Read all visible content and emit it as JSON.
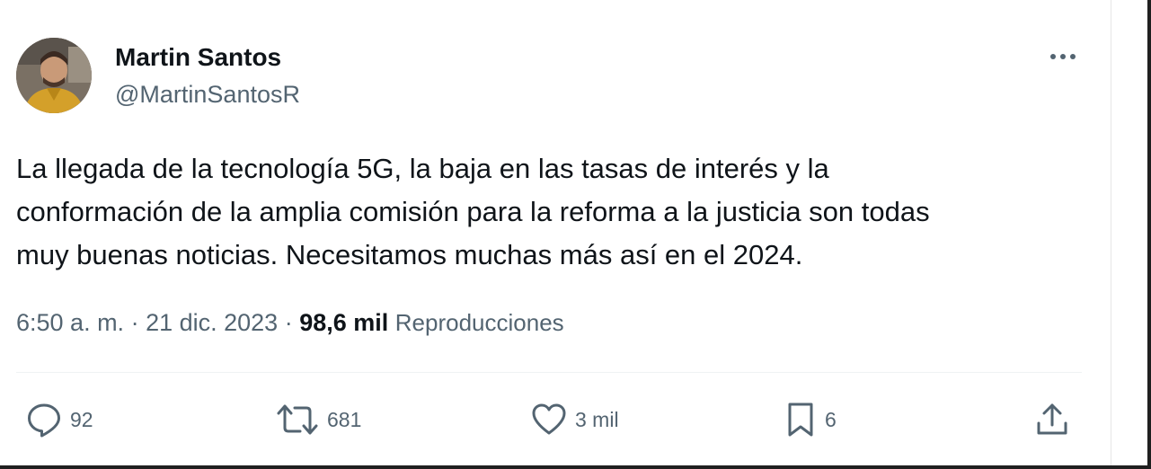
{
  "author": {
    "display_name": "Martin Santos",
    "handle": "@MartinSantosR"
  },
  "tweet": {
    "text_lines": [
      "La llegada de la tecnología 5G, la baja en las tasas de interés y la",
      "conformación de la amplia comisión para la reforma a la justicia son todas",
      "muy buenas noticias. Necesitamos muchas más así en el 2024."
    ]
  },
  "meta": {
    "time": "6:50 a. m.",
    "separator": " · ",
    "date": "21 dic. 2023",
    "separator2": " · ",
    "views_count": "98,6 mil",
    "views_label": "Reproducciones"
  },
  "actions": {
    "replies": "92",
    "reposts": "681",
    "likes": "3 mil",
    "bookmarks": "6"
  },
  "icons": {
    "more": "more-horizontal-icon",
    "reply": "reply-bubble-icon",
    "repost": "repost-arrows-icon",
    "like": "heart-icon",
    "bookmark": "bookmark-icon",
    "share": "share-upload-icon"
  },
  "colors": {
    "text_primary": "#0f1419",
    "text_secondary": "#536471",
    "divider": "#eff3f4"
  }
}
